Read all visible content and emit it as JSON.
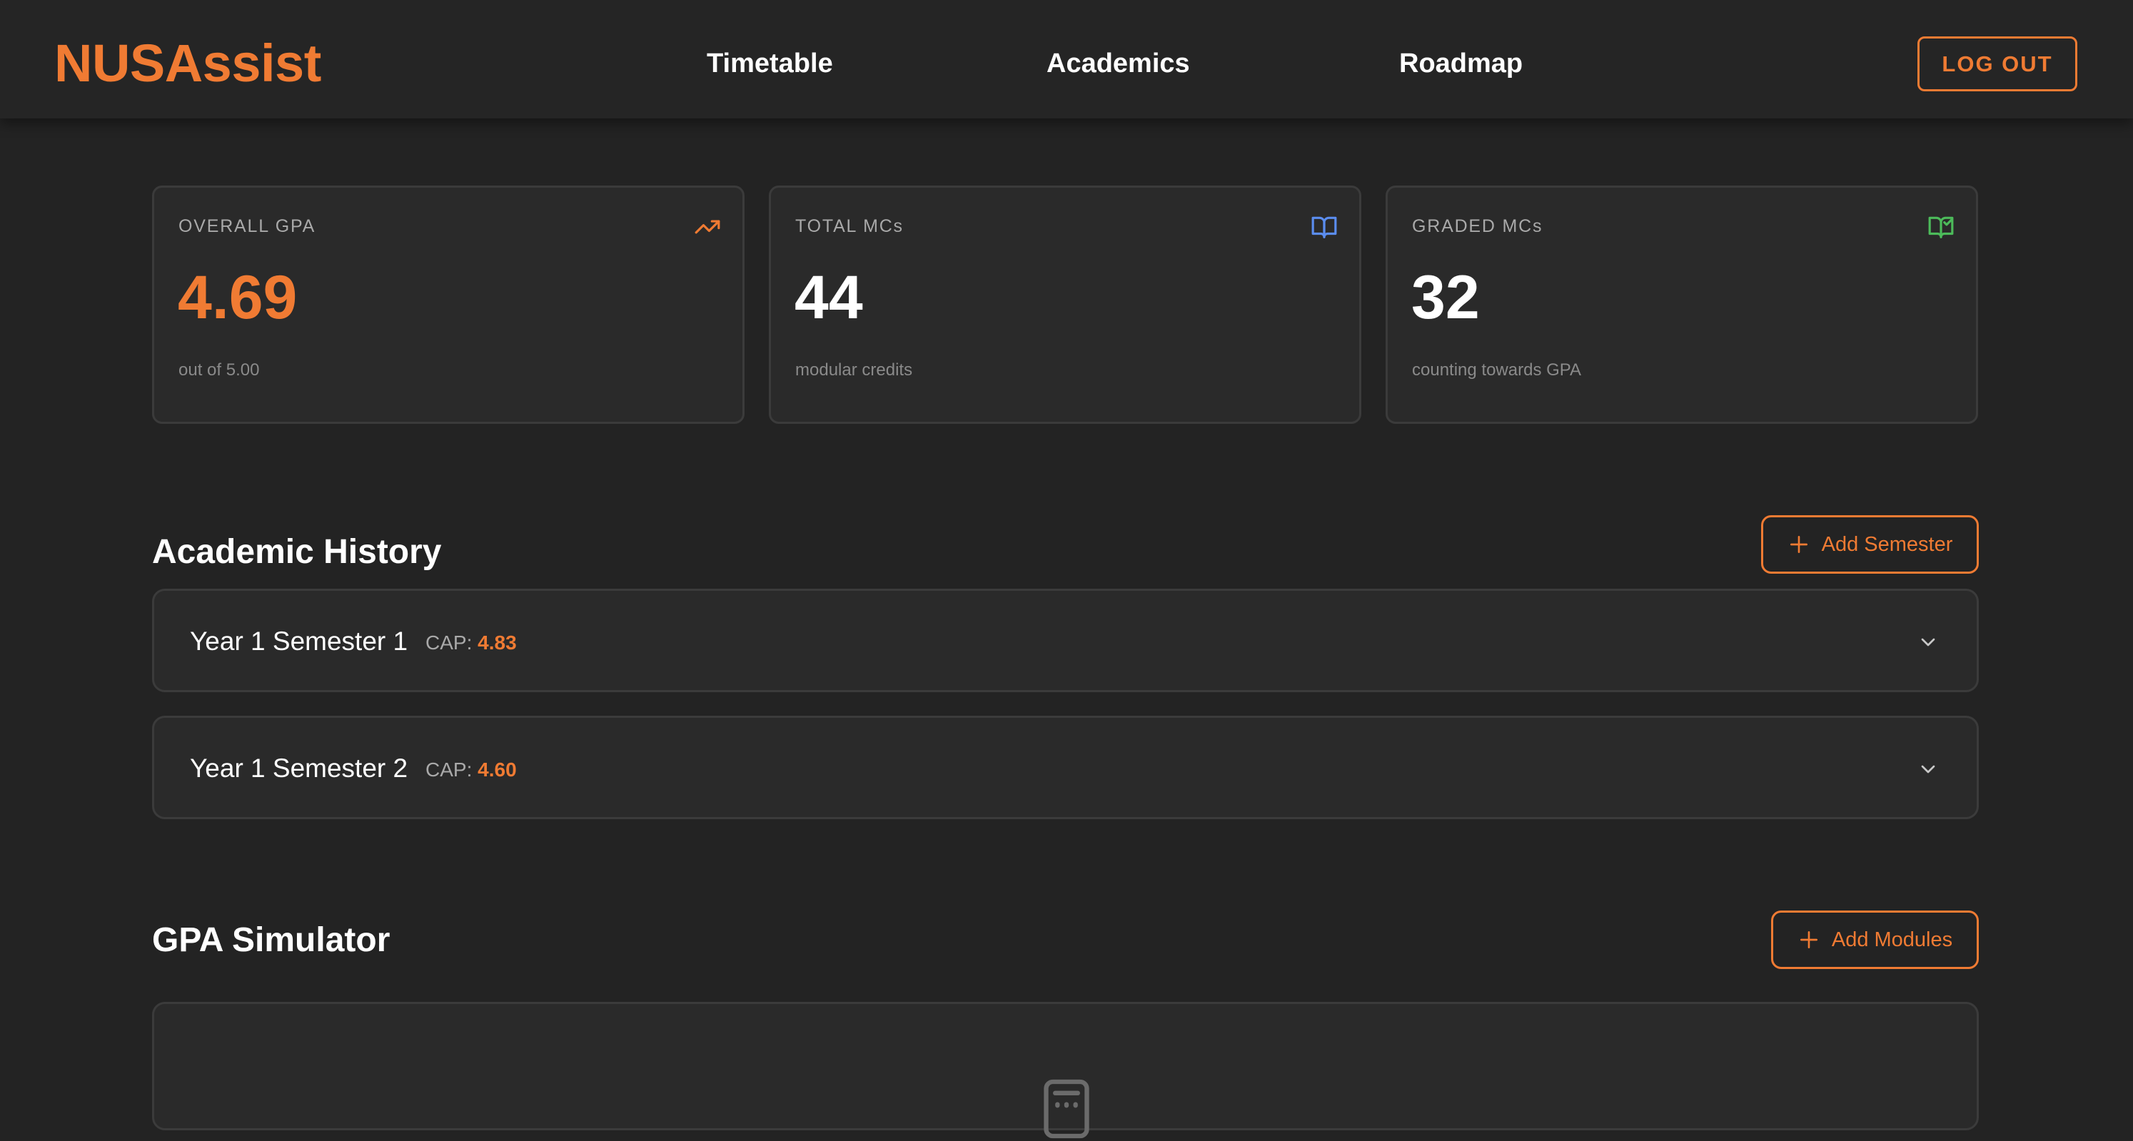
{
  "header": {
    "brand": "NUSAssist",
    "nav": [
      "Timetable",
      "Academics",
      "Roadmap"
    ],
    "logout_label": "LOG OUT"
  },
  "stats": [
    {
      "label": "OVERALL GPA",
      "value": "4.69",
      "sub": "out of 5.00",
      "icon": "trending-up-icon",
      "icon_color": "#f07b33"
    },
    {
      "label": "TOTAL MCs",
      "value": "44",
      "sub": "modular credits",
      "icon": "book-open-icon",
      "icon_color": "#5b8def"
    },
    {
      "label": "GRADED MCs",
      "value": "32",
      "sub": "counting towards GPA",
      "icon": "book-check-icon",
      "icon_color": "#4cbb5a"
    }
  ],
  "history": {
    "title": "Academic History",
    "add_label": "Add Semester",
    "cap_label": "CAP:",
    "semesters": [
      {
        "name": "Year 1 Semester 1",
        "cap": "4.83"
      },
      {
        "name": "Year 1 Semester 2",
        "cap": "4.60"
      }
    ]
  },
  "simulator": {
    "title": "GPA Simulator",
    "add_label": "Add Modules",
    "empty_icon": "calculator-icon"
  },
  "colors": {
    "accent": "#f07b33",
    "background": "#232323",
    "card": "#2a2a2a",
    "border": "#3b3b3b"
  }
}
